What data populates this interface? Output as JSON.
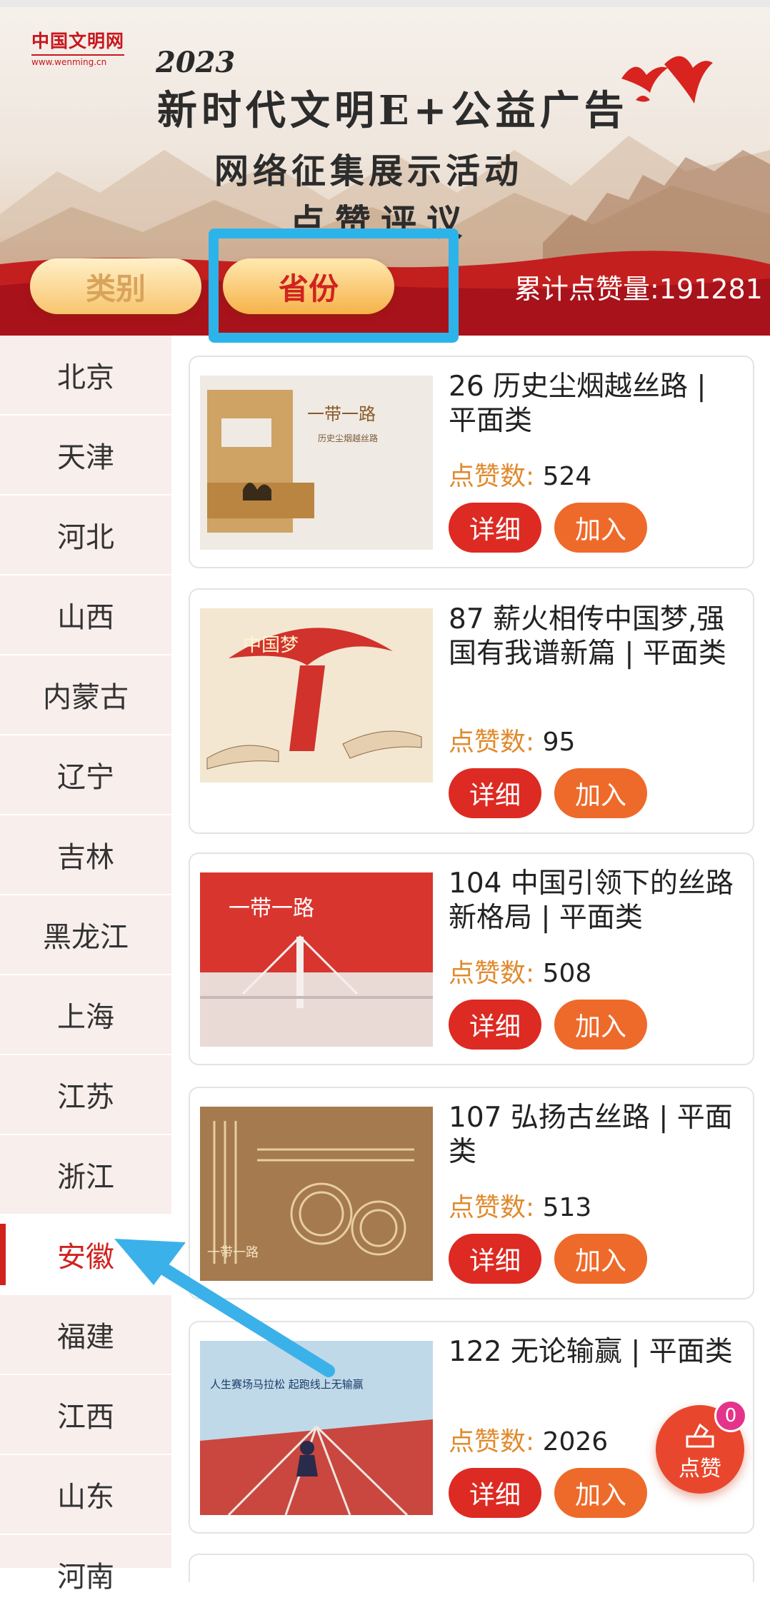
{
  "banner": {
    "logo_main": "中国文明网",
    "logo_sub": "www.wenming.cn",
    "year": "2023",
    "title_line1": "新时代文明E+公益广告",
    "title_line2": "网络征集展示活动",
    "title_line3": "点赞评议",
    "tabs": [
      {
        "label": "类别",
        "selected": false
      },
      {
        "label": "省份",
        "selected": true
      }
    ],
    "total_likes": "累计点赞量:191281"
  },
  "sidebar": {
    "items": [
      "北京",
      "天津",
      "河北",
      "山西",
      "内蒙古",
      "辽宁",
      "吉林",
      "黑龙江",
      "上海",
      "江苏",
      "浙江",
      "安徽",
      "福建",
      "江西",
      "山东",
      "河南"
    ],
    "active": "安徽"
  },
  "cards": [
    {
      "title": "26 历史尘烟越丝路 | 平面类",
      "likes_label": "点赞数:",
      "likes": "524",
      "detail": "详细",
      "join": "加入",
      "thumb_text": "一带一路"
    },
    {
      "title": "87 薪火相传中国梦,强国有我谱新篇 | 平面类",
      "likes_label": "点赞数:",
      "likes": "95",
      "detail": "详细",
      "join": "加入",
      "thumb_text": "中国梦"
    },
    {
      "title": "104 中国引领下的丝路新格局 | 平面类",
      "likes_label": "点赞数:",
      "likes": "508",
      "detail": "详细",
      "join": "加入",
      "thumb_text": "一带一路"
    },
    {
      "title": "107 弘扬古丝路 | 平面类",
      "likes_label": "点赞数:",
      "likes": "513",
      "detail": "详细",
      "join": "加入",
      "thumb_text": "一带一路"
    },
    {
      "title": "122 无论输赢 | 平面类",
      "likes_label": "点赞数:",
      "likes": "2026",
      "detail": "详细",
      "join": "加入",
      "thumb_text": "人生赛场马拉松 起跑线上无输赢"
    }
  ],
  "vote": {
    "label": "点赞",
    "badge": "0"
  },
  "colors": {
    "brand_red": "#d0231f",
    "accent_orange": "#ee6a2a",
    "highlight_blue": "#2cb4ea"
  }
}
